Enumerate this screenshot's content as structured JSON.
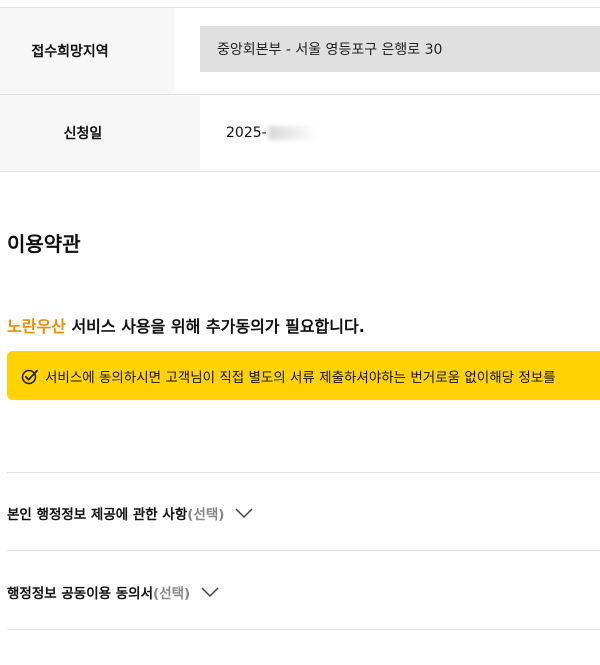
{
  "form": {
    "region_label": "접수희망지역",
    "region_value": "중앙회본부 - 서울 영등포구 은행로 30",
    "date_label": "신청일",
    "date_value": "2025-"
  },
  "terms": {
    "section_title": "이용약관",
    "brand": "노란우산",
    "consent_heading_rest": " 서비스 사용을 위해 추가동의가 필요합니다.",
    "notice_text": "서비스에 동의하시면 고객님이 직접 별도의 서류 제출하셔야하는 번거로움 없이해당 정보를",
    "notice_icon": "check-circle-icon"
  },
  "accordions": [
    {
      "title": "본인 행정정보 제공에 관한 사항",
      "optional": "(선택)",
      "icon": "chevron-down-icon"
    },
    {
      "title": "행정정보 공동이용 동의서",
      "optional": "(선택)",
      "icon": "chevron-down-icon"
    }
  ],
  "colors": {
    "brand": "#f28c00",
    "notice_bg": "#ffd200",
    "readonly_bg": "#e0e0e0",
    "label_bg": "#f7f7f7"
  }
}
